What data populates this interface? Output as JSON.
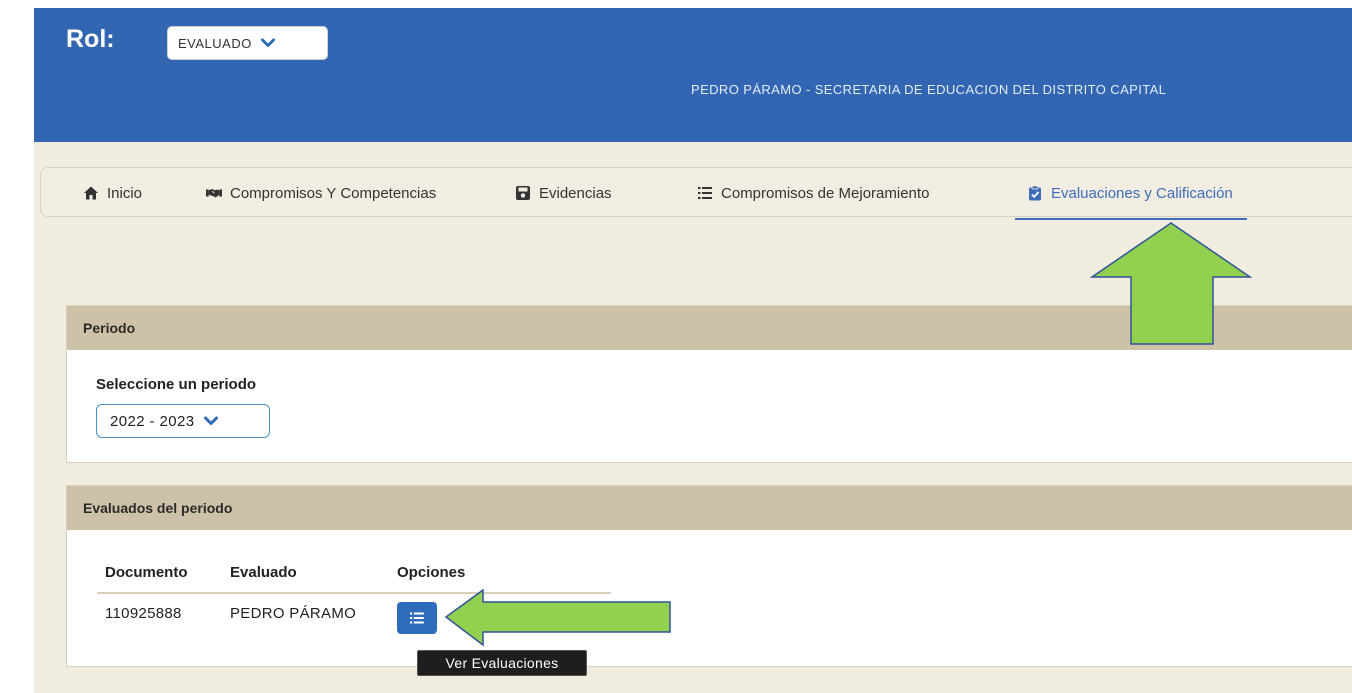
{
  "header": {
    "rol_label": "Rol:",
    "rol_value": "EVALUADO",
    "user_line": "PEDRO PÁRAMO - SECRETARIA DE EDUCACION DEL DISTRITO CAPITAL"
  },
  "nav": {
    "items": [
      {
        "label": "Inicio",
        "icon": "home-icon"
      },
      {
        "label": "Compromisos Y Competencias",
        "icon": "handshake-icon"
      },
      {
        "label": "Evidencias",
        "icon": "save-icon"
      },
      {
        "label": "Compromisos de Mejoramiento",
        "icon": "list-icon"
      },
      {
        "label": "Evaluaciones y Calificación",
        "icon": "clipboard-check-icon",
        "active": true
      }
    ]
  },
  "periodo": {
    "title": "Periodo",
    "select_label": "Seleccione un periodo",
    "selected": "2022 - 2023"
  },
  "evaluados": {
    "title": "Evaluados del periodo",
    "columns": [
      "Documento",
      "Evaluado",
      "Opciones"
    ],
    "rows": [
      {
        "documento": "110925888",
        "evaluado": "PEDRO PÁRAMO"
      }
    ],
    "tooltip": "Ver Evaluaciones"
  },
  "colors": {
    "header_bg": "#3266b2",
    "active_tab": "#3d6db7",
    "panel_head": "#cdc2a7",
    "annotation_arrow": "#92d050"
  }
}
